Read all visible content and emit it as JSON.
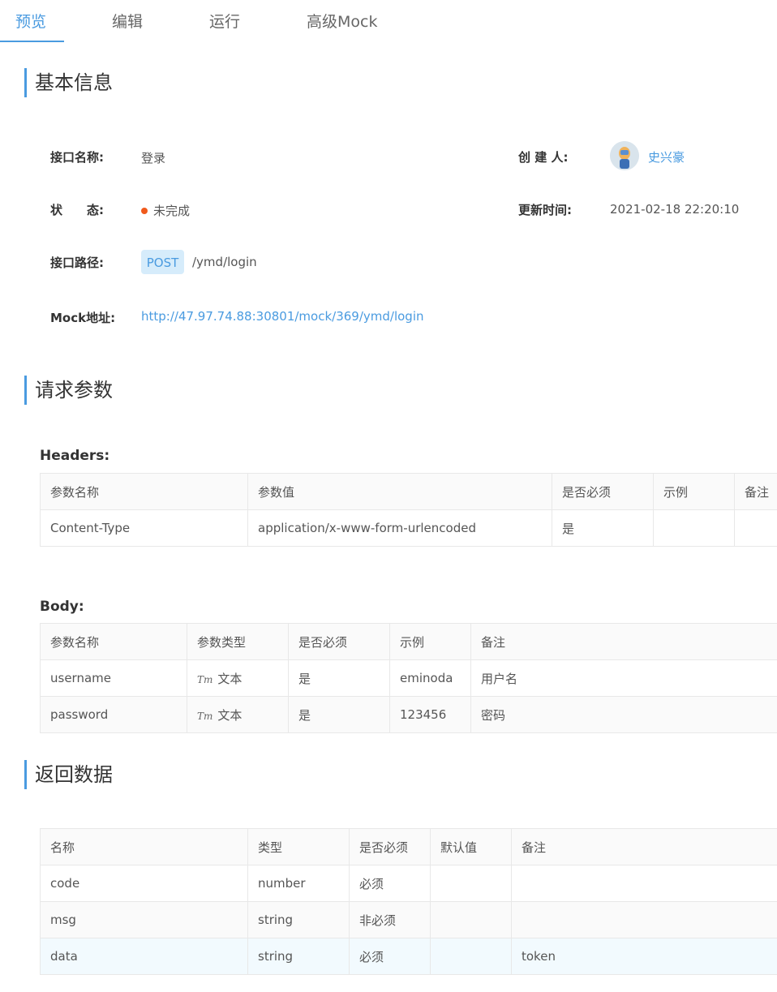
{
  "tabs": [
    {
      "label": "预览"
    },
    {
      "label": "编辑"
    },
    {
      "label": "运行"
    },
    {
      "label": "高级Mock"
    }
  ],
  "sections": {
    "basic": "基本信息",
    "request": "请求参数",
    "response": "返回数据"
  },
  "basic": {
    "name_label": "接口名称:",
    "name_value": "登录",
    "creator_label": "创 建 人:",
    "creator_value": "史兴豪",
    "status_label": "状　　态:",
    "status_value": "未完成",
    "updated_label": "更新时间:",
    "updated_value": "2021-02-18 22:20:10",
    "path_label": "接口路径:",
    "method": "POST",
    "path_value": "/ymd/login",
    "mock_label": "Mock地址:",
    "mock_value": "http://47.97.74.88:30801/mock/369/ymd/login",
    "status_color": "#f05a1c",
    "accent_color": "#4a9be0"
  },
  "headers": {
    "title": "Headers:",
    "columns": [
      "参数名称",
      "参数值",
      "是否必须",
      "示例",
      "备注"
    ],
    "rows": [
      [
        "Content-Type",
        "application/x-www-form-urlencoded",
        "是",
        "",
        ""
      ]
    ]
  },
  "body": {
    "title": "Body:",
    "columns": [
      "参数名称",
      "参数类型",
      "是否必须",
      "示例",
      "备注"
    ],
    "type_icon": "Tт",
    "rows": [
      [
        "username",
        "文本",
        "是",
        "eminoda",
        "用户名"
      ],
      [
        "password",
        "文本",
        "是",
        "123456",
        "密码"
      ]
    ]
  },
  "response": {
    "columns": [
      "名称",
      "类型",
      "是否必须",
      "默认值",
      "备注"
    ],
    "rows": [
      [
        "code",
        "number",
        "必须",
        "",
        ""
      ],
      [
        "msg",
        "string",
        "非必须",
        "",
        ""
      ],
      [
        "data",
        "string",
        "必须",
        "",
        "token"
      ]
    ]
  }
}
